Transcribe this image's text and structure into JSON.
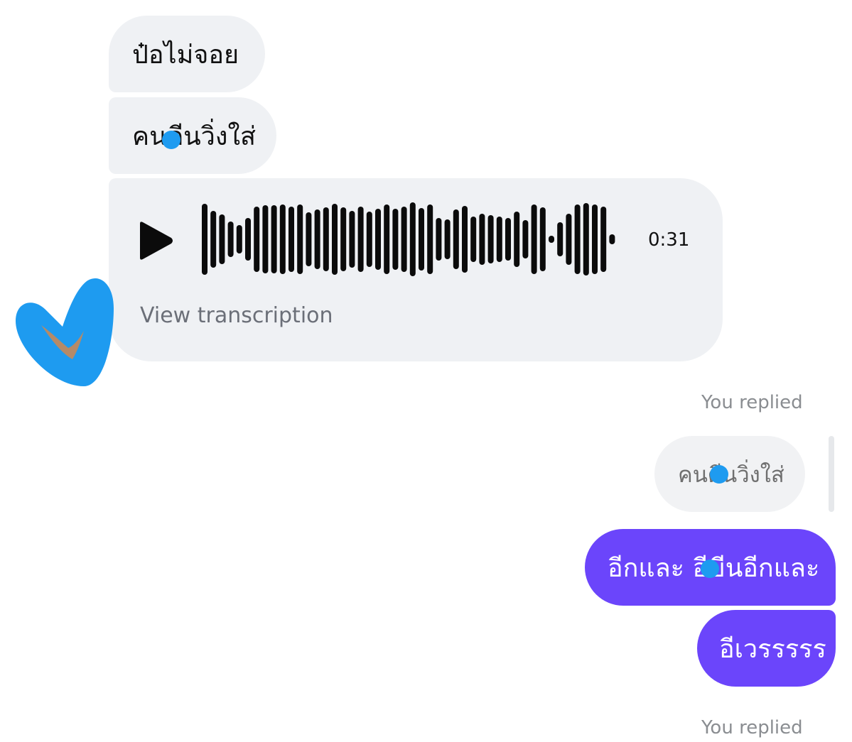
{
  "colors": {
    "incoming_bubble": "#eff1f4",
    "outgoing_bubble": "#6b45fb",
    "quoted_bubble": "#f1f2f4",
    "meta_text": "#8a8d91",
    "annotation": "#1e9bf0"
  },
  "messages": {
    "incoming": [
      "ป๋อไม่จอย",
      "คนดีนวิ่งใส่"
    ],
    "voice": {
      "icon": "play-icon",
      "duration": "0:31",
      "transcription_link": "View transcription"
    },
    "reply_1": {
      "label": "You replied",
      "quoted_text": "คนดีนวิ่งใส่"
    },
    "outgoing": [
      "อีกและ อีขีนอีกและ",
      "อีเวรรรรร"
    ],
    "reply_2": {
      "label": "You replied"
    }
  },
  "reaction": {
    "icon": "heart-icon"
  }
}
